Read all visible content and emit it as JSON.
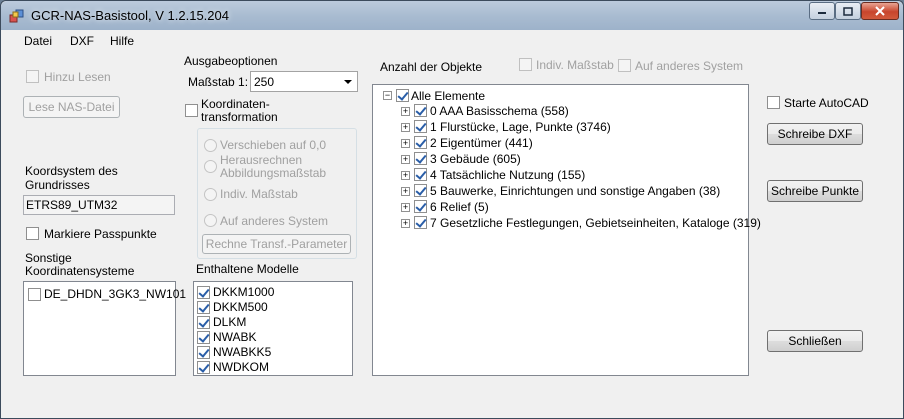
{
  "window": {
    "title": "GCR-NAS-Basistool, V 1.2.15.204"
  },
  "menu": [
    "Datei",
    "DXF",
    "Hilfe"
  ],
  "left": {
    "hinzu_lesen": "Hinzu Lesen",
    "lese_nas": "Lese NAS-Datei",
    "koordsystem_label_1": "Koordsystem des",
    "koordsystem_label_2": "Grundrisses",
    "koordsystem_value": "ETRS89_UTM32",
    "markiere": "Markiere Passpunkte",
    "sonstige_1": "Sonstige",
    "sonstige_2": "Koordinatensysteme",
    "sonstige_items": [
      "DE_DHDN_3GK3_NW101"
    ]
  },
  "ausgabe": {
    "title": "Ausgabeoptionen",
    "massstab_label": "Maßstab 1:",
    "massstab_value": "250",
    "koord_trans_1": "Koordinaten-",
    "koord_trans_2": "transformation",
    "options": {
      "verschieben": "Verschieben auf 0,0",
      "herausrechnen_1": "Herausrechnen",
      "herausrechnen_2": "Abbildungsmaßstab",
      "indiv": "Indiv. Maßstab",
      "anderes": "Auf anderes System"
    },
    "rechne": "Rechne Transf.-Parameter"
  },
  "modelle": {
    "title": "Enthaltene Modelle",
    "items": [
      "DKKM1000",
      "DKKM500",
      "DLKM",
      "NWABK",
      "NWABKK5",
      "NWDKOM"
    ]
  },
  "objekte": {
    "title": "Anzahl der Objekte",
    "indiv": "Indiv. Maßstab",
    "anderes": "Auf anderes System",
    "root": "Alle Elemente",
    "items": [
      "0 AAA Basisschema (558)",
      "1 Flurstücke, Lage, Punkte (3746)",
      "2 Eigentümer (441)",
      "3 Gebäude (605)",
      "4 Tatsächliche Nutzung (155)",
      "5 Bauwerke, Einrichtungen und sonstige Angaben (38)",
      "6 Relief (5)",
      "7 Gesetzliche Festlegungen, Gebietseinheiten, Kataloge (319)"
    ]
  },
  "right": {
    "starte_autocad": "Starte AutoCAD",
    "schreibe_dxf": "Schreibe DXF",
    "schreibe_punkte": "Schreibe Punkte",
    "schliessen": "Schließen"
  }
}
